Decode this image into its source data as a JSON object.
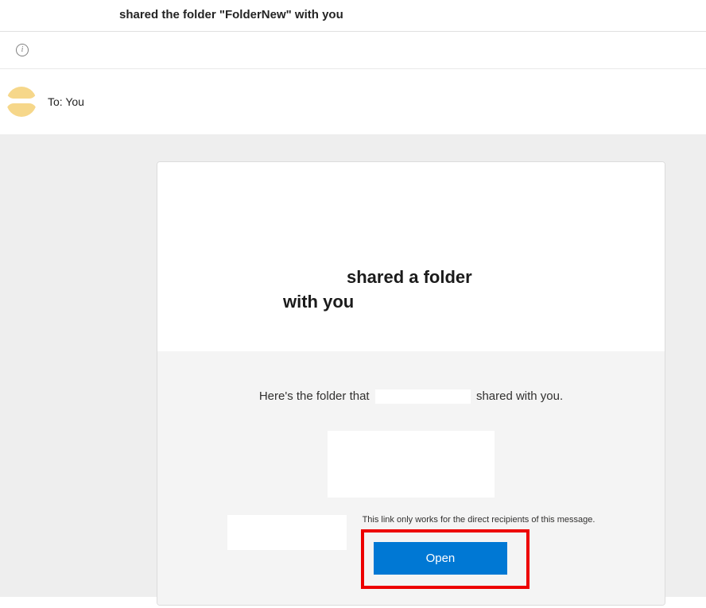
{
  "header": {
    "subject": "shared the folder \"FolderNew\" with you",
    "to_label": "To:",
    "to_value": "You"
  },
  "card": {
    "title_line1": "shared a folder",
    "title_line2": "with you",
    "intro_prefix": "Here's the folder that",
    "intro_suffix": "shared with you.",
    "disclaimer": "This link only works for the direct recipients of this message.",
    "open_label": "Open"
  }
}
